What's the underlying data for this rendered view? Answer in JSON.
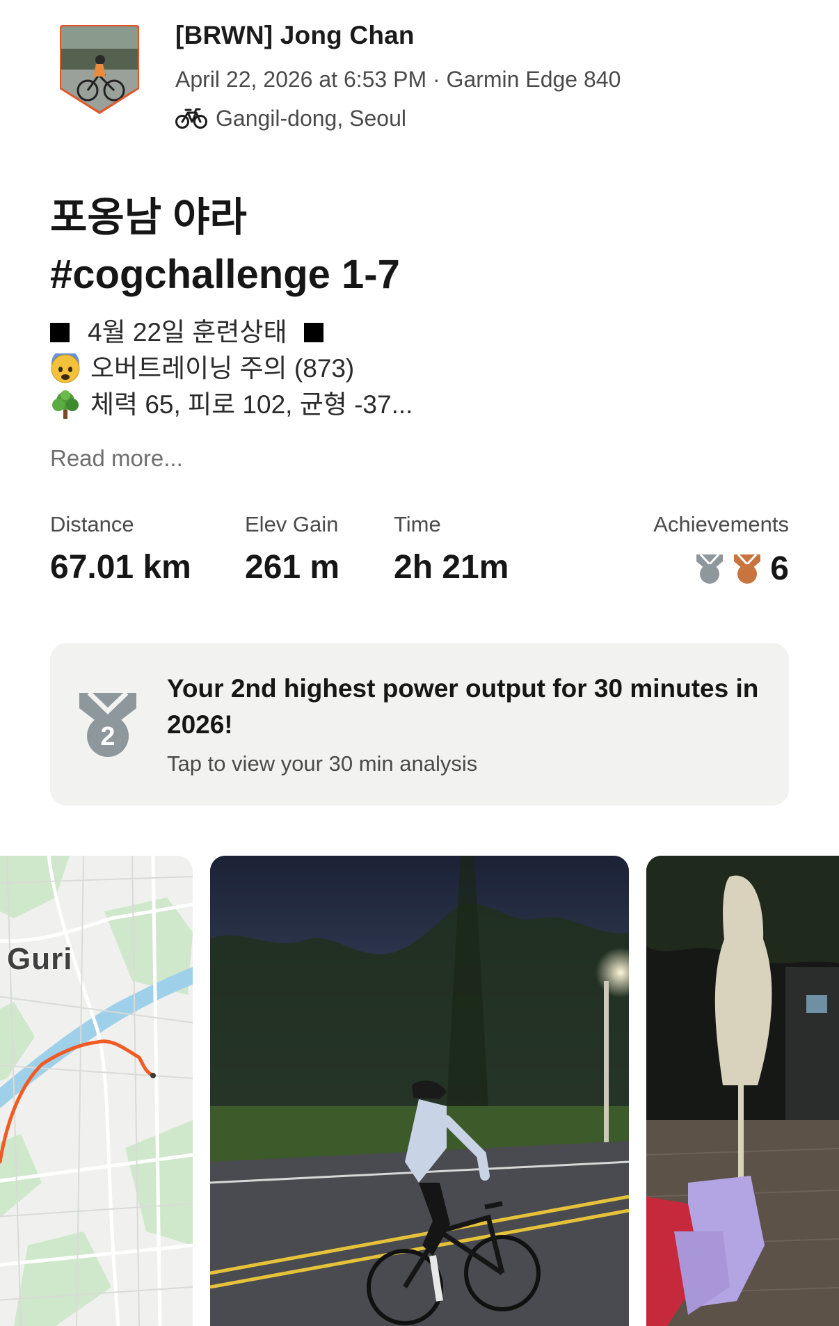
{
  "athlete": {
    "name": "[BRWN] Jong Chan",
    "meta": "April 22, 2026 at 6:53 PM · Garmin Edge 840",
    "location": "Gangil-dong, Seoul",
    "activity_icon": "bike-icon",
    "avatar": "shield-avatar"
  },
  "activity": {
    "title_line1": "포옹남 야라",
    "title_line2": "#cogchallenge 1-7",
    "description": {
      "line1": "4월 22일 훈련상태",
      "line2": "오버트레이닝 주의 (873)",
      "line3": "체력 65, 피로 102, 균형 -37..."
    },
    "read_more": "Read more..."
  },
  "stats": {
    "distance_label": "Distance",
    "distance_value": "67.01 km",
    "elev_label": "Elev Gain",
    "elev_value": "261 m",
    "time_label": "Time",
    "time_value": "2h 21m",
    "achievements_label": "Achievements",
    "achievements_count": "6"
  },
  "achievement_card": {
    "title": "Your 2nd highest power output for 30 minutes in 2026!",
    "subtitle": "Tap to view your 30 min analysis",
    "medal_rank": "2"
  },
  "media": {
    "map_label": "Guri"
  },
  "colors": {
    "route": "#f05a24",
    "silver_medal": "#8e979c",
    "bronze_medal": "#c8743f",
    "avatar_border": "#e2552a",
    "card_bg": "#f2f2f1"
  }
}
